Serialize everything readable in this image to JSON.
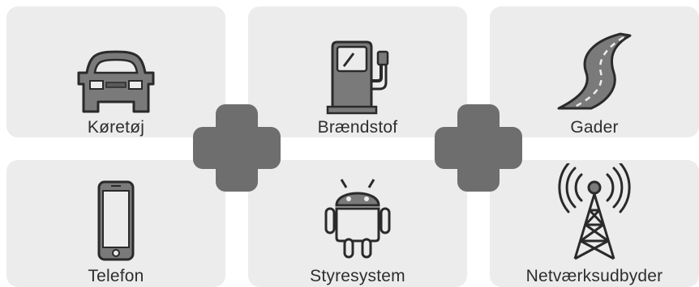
{
  "tiles": {
    "vehicle": {
      "label": "Køretøj",
      "icon": "car-icon"
    },
    "fuel": {
      "label": "Brændstof",
      "icon": "fuel-pump-icon"
    },
    "streets": {
      "label": "Gader",
      "icon": "road-icon"
    },
    "phone": {
      "label": "Telefon",
      "icon": "smartphone-icon"
    },
    "os": {
      "label": "Styresystem",
      "icon": "android-icon"
    },
    "network": {
      "label": "Netværksudbyder",
      "icon": "cell-tower-icon"
    }
  },
  "connectors": [
    "plus-icon",
    "plus-icon"
  ],
  "colors": {
    "tile_bg": "#ececec",
    "icon_fill": "#7a7a7a",
    "icon_stroke": "#2a2a2a",
    "plus": "#6e6e6e"
  }
}
